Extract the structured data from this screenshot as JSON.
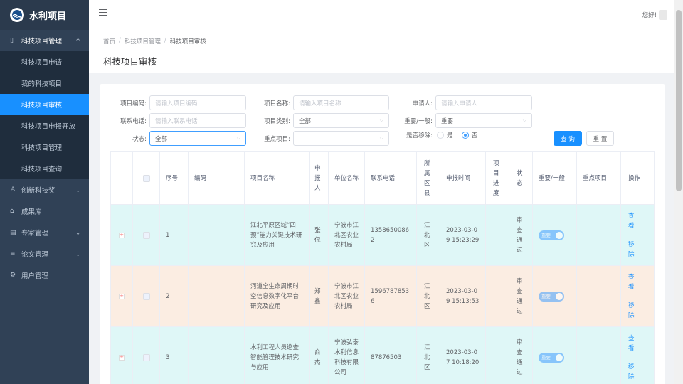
{
  "app": {
    "title": "水利项目"
  },
  "sidebar": {
    "group": {
      "label": "科技项目管理"
    },
    "sub_items": [
      {
        "label": "科技项目申请"
      },
      {
        "label": "我的科技项目"
      },
      {
        "label": "科技项目审核"
      },
      {
        "label": "科技项目申报开放"
      },
      {
        "label": "科技项目管理"
      },
      {
        "label": "科技项目查询"
      }
    ],
    "items": [
      {
        "label": "创新科技奖"
      },
      {
        "label": "成果库"
      },
      {
        "label": "专家管理"
      },
      {
        "label": "论文管理"
      },
      {
        "label": "用户管理"
      }
    ]
  },
  "navbar": {
    "greeting": "您好!"
  },
  "breadcrumb": {
    "home": "首页",
    "level1": "科技项目管理",
    "current": "科技项目审核"
  },
  "page": {
    "title": "科技项目审核"
  },
  "filters": {
    "code": {
      "label": "项目编码:",
      "placeholder": "请输入项目编码"
    },
    "name": {
      "label": "项目名称:",
      "placeholder": "请输入项目名称"
    },
    "applicant": {
      "label": "申请人:",
      "placeholder": "请输入申请人"
    },
    "phone": {
      "label": "联系电话:",
      "placeholder": "请输入联系电话"
    },
    "category": {
      "label": "项目类别:",
      "value": "全部"
    },
    "importance": {
      "label": "重要/一般:",
      "value": "重要"
    },
    "status": {
      "label": "状态:",
      "value": "全部"
    },
    "key_project": {
      "label": "重点项目:",
      "value": ""
    },
    "removed": {
      "label": "是否移除:",
      "yes": "是",
      "no": "否",
      "selected": "否"
    },
    "search_btn": "查 询",
    "reset_btn": "重 置"
  },
  "table": {
    "headers": {
      "seq": "序号",
      "code": "编码",
      "name": "项目名称",
      "applicant": "申报人",
      "unit": "单位名称",
      "phone": "联系电话",
      "region": "所属区县",
      "time": "申报时间",
      "progress": "项目进度",
      "status": "状态",
      "importance": "重要/一般",
      "key": "重点项目",
      "ops": "操作"
    },
    "rows": [
      {
        "seq": "1",
        "code": "",
        "name": "江北平原区域“四预”能力关键技术研究及应用",
        "applicant": "张侃",
        "unit": "宁波市江北区农业农村局",
        "phone": "13586500862",
        "region": "江北区",
        "time": "2023-03-09 15:23:29",
        "progress": "",
        "status": "审查通过",
        "importance": "重要",
        "key": "",
        "view": "查看",
        "remove": "移除"
      },
      {
        "seq": "2",
        "code": "",
        "name": "河道全生命周期时空信息数字化平台研究及应用",
        "applicant": "郑鑫",
        "unit": "宁波市江北区农业农村局",
        "phone": "15967878536",
        "region": "江北区",
        "time": "2023-03-09 15:13:53",
        "progress": "",
        "status": "审查通过",
        "importance": "重要",
        "key": "",
        "view": "查看",
        "remove": "移除"
      },
      {
        "seq": "3",
        "code": "",
        "name": "水利工程人员巡查智能管理技术研究与应用",
        "applicant": "俞杰",
        "unit": "宁波弘泰水利信息科技有限公司",
        "phone": "87876503",
        "region": "江北区",
        "time": "2023-03-07 10:18:20",
        "progress": "",
        "status": "审查通过",
        "importance": "重要",
        "key": "",
        "view": "查看",
        "remove": "移除"
      }
    ]
  }
}
